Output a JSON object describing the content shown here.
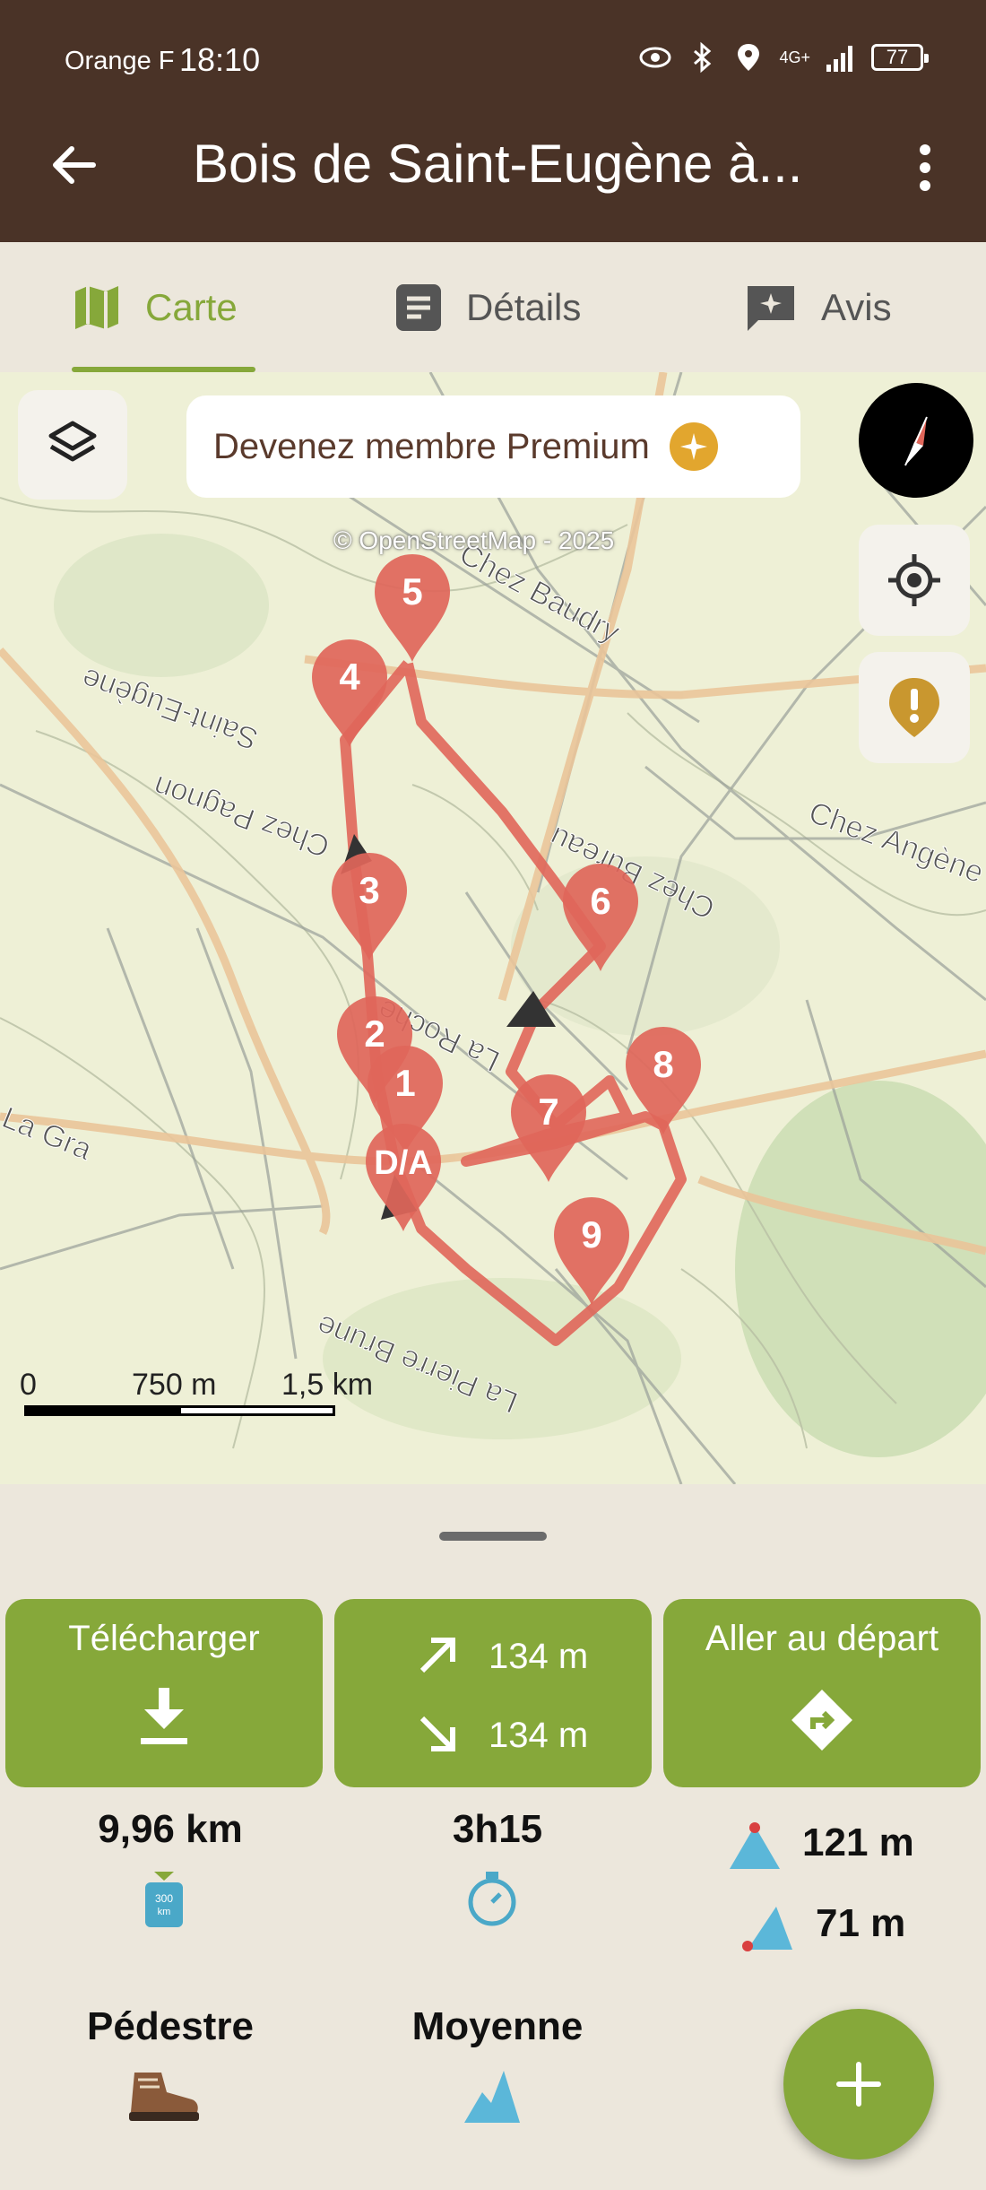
{
  "status": {
    "carrier": "Orange F",
    "time": "18:10",
    "network": "4G+",
    "battery": "77"
  },
  "appbar": {
    "title": "Bois de Saint-Eugène à..."
  },
  "tabs": [
    {
      "label": "Carte",
      "icon": "map-icon",
      "active": true
    },
    {
      "label": "Détails",
      "icon": "document-icon",
      "active": false
    },
    {
      "label": "Avis",
      "icon": "review-icon",
      "active": false
    }
  ],
  "map": {
    "premium_label": "Devenez membre Premium",
    "attribution": "© OpenStreetMap - 2025",
    "scale": [
      "0",
      "750 m",
      "1,5 km"
    ],
    "waypoints": [
      "5",
      "4",
      "3",
      "6",
      "2",
      "1",
      "8",
      "7",
      "D/A",
      "9"
    ],
    "place_labels": [
      "Chez Baudry",
      "Saint-Eugène",
      "Chez Pagnon",
      "Chez Bureau",
      "Chez Angène",
      "La Roche",
      "La Pierre Brune",
      "La Gra"
    ],
    "route_color": "#e0665a"
  },
  "actions": {
    "download_label": "Télécharger",
    "ascent": "134 m",
    "descent": "134 m",
    "goto_label": "Aller au départ"
  },
  "stats": {
    "distance": "9,96 km",
    "duration": "3h15",
    "alt_max": "121 m",
    "alt_min": "71 m",
    "activity": "Pédestre",
    "difficulty": "Moyenne"
  },
  "colors": {
    "accent": "#86a83a",
    "header": "#4a3327"
  }
}
